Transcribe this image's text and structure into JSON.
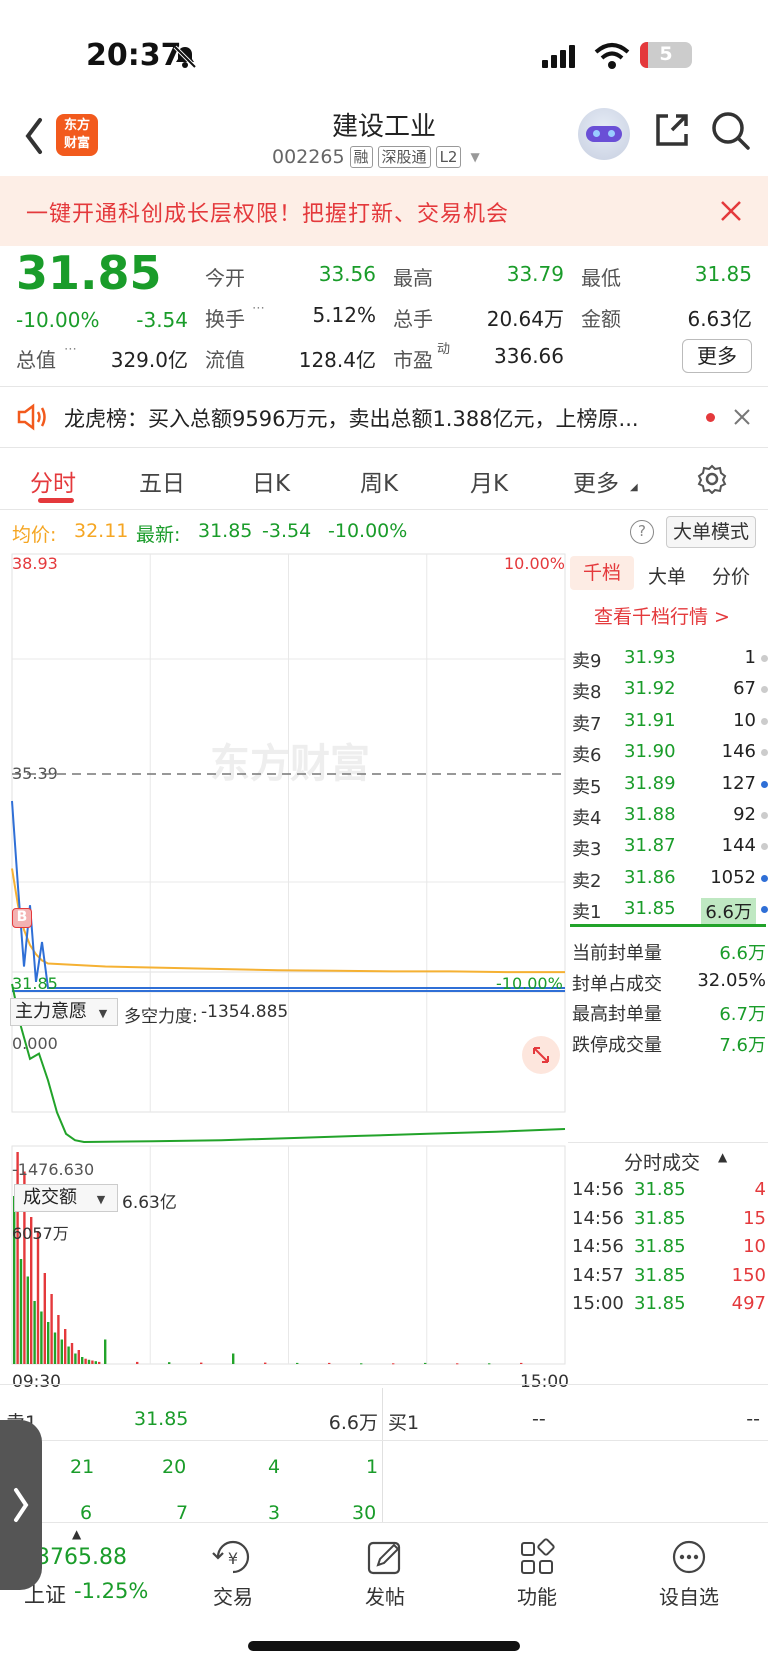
{
  "status_bar": {
    "time": "20:37",
    "battery": "5"
  },
  "header": {
    "logo_text": "东方\n财富",
    "title": "建设工业",
    "code": "002265",
    "tags": [
      "融",
      "深股通",
      "L2"
    ]
  },
  "banner": {
    "text": "一键开通科创成长层权限！把握打新、交易机会"
  },
  "quote": {
    "price": "31.85",
    "change_pct": "-10.00%",
    "change": "-3.54",
    "open_label": "今开",
    "open": "33.56",
    "high_label": "最高",
    "high": "33.79",
    "low_label": "最低",
    "low": "31.85",
    "turnover_label": "换手",
    "turnover": "5.12%",
    "volume_label": "总手",
    "volume": "20.64万",
    "amount_label": "金额",
    "amount": "6.63亿",
    "mktcap_label": "总值",
    "mktcap": "329.0亿",
    "float_label": "流值",
    "float_cap": "128.4亿",
    "pe_label": "市盈",
    "pe_sup": "动",
    "pe": "336.66",
    "more_label": "更多"
  },
  "dragon_tiger": {
    "text": "龙虎榜：买入总额9596万元，卖出总额1.388亿元，上榜原..."
  },
  "tabs": [
    "分时",
    "五日",
    "日K",
    "周K",
    "月K",
    "更多"
  ],
  "info_line": {
    "avg_label": "均价:",
    "avg": "32.11",
    "latest_label": "最新:",
    "latest": "31.85",
    "change": "-3.54",
    "pct": "-10.00%",
    "mode_button": "大单模式"
  },
  "chart": {
    "y_top": "38.93",
    "y_mid": "35.39",
    "y_bottom": "31.85",
    "pct_top": "10.00%",
    "pct_bottom": "-10.00%",
    "watermark": "东方财富",
    "b_marker": "B",
    "indicator_label": "主力意愿",
    "indicator_title": "多空力度:",
    "indicator_value": "-1354.885",
    "indicator_top": "0.000",
    "indicator_bottom": "-1476.630",
    "volume_label": "成交额",
    "volume_total": "6.63亿",
    "volume_max": "6057万",
    "time_start": "09:30",
    "time_end": "15:00"
  },
  "chart_data": {
    "type": "line",
    "x_range": [
      "09:30",
      "15:00"
    ],
    "ylim": [
      31.85,
      38.93
    ],
    "price_series": [
      34.9,
      33.5,
      32.2,
      33.2,
      31.95,
      32.6,
      31.85,
      31.85,
      31.85,
      31.85,
      31.85,
      31.85,
      31.85,
      31.85,
      31.85,
      31.85
    ],
    "avg_series": [
      33.8,
      33.2,
      32.8,
      32.55,
      32.4,
      32.3,
      32.25,
      32.2,
      32.18,
      32.16,
      32.14,
      32.13,
      32.12,
      32.12,
      32.11,
      32.11
    ],
    "indicator_series": [
      0,
      -400,
      -700,
      -650,
      -900,
      -1200,
      -1400,
      -1460,
      -1476.63,
      -1470,
      -1460,
      -1440,
      -1420,
      -1400,
      -1380,
      -1354.885
    ],
    "volume_series": [
      4800,
      6057,
      3000,
      5500,
      2500,
      4200,
      1800,
      3800,
      1500,
      2600,
      1200,
      2000,
      900,
      1400,
      700,
      1000,
      500,
      600,
      300,
      400,
      200,
      150,
      120,
      100,
      80,
      60,
      700,
      60,
      50,
      40,
      300,
      40,
      30,
      30,
      20,
      20,
      30,
      20,
      20,
      30
    ]
  },
  "order_book": {
    "tabs": [
      "千档",
      "大单",
      "分价"
    ],
    "link": "查看千档行情 >",
    "asks": [
      {
        "label": "卖9",
        "price": "31.93",
        "vol": "1"
      },
      {
        "label": "卖8",
        "price": "31.92",
        "vol": "67"
      },
      {
        "label": "卖7",
        "price": "31.91",
        "vol": "10"
      },
      {
        "label": "卖6",
        "price": "31.90",
        "vol": "146"
      },
      {
        "label": "卖5",
        "price": "31.89",
        "vol": "127"
      },
      {
        "label": "卖4",
        "price": "31.88",
        "vol": "92"
      },
      {
        "label": "卖3",
        "price": "31.87",
        "vol": "144"
      },
      {
        "label": "卖2",
        "price": "31.86",
        "vol": "1052"
      },
      {
        "label": "卖1",
        "price": "31.85",
        "vol": "6.6万"
      }
    ],
    "stats": [
      {
        "label": "当前封单量",
        "value": "6.6万"
      },
      {
        "label": "封单占成交",
        "value": "32.05%"
      },
      {
        "label": "最高封单量",
        "value": "6.7万"
      },
      {
        "label": "跌停成交量",
        "value": "7.6万"
      }
    ],
    "ticks_title": "分时成交",
    "ticks": [
      {
        "time": "14:56",
        "price": "31.85",
        "vol": "4"
      },
      {
        "time": "14:56",
        "price": "31.85",
        "vol": "15"
      },
      {
        "time": "14:56",
        "price": "31.85",
        "vol": "10"
      },
      {
        "time": "14:57",
        "price": "31.85",
        "vol": "150"
      },
      {
        "time": "15:00",
        "price": "31.85",
        "vol": "497"
      }
    ]
  },
  "bottom_quote": {
    "sell1_label": "卖1",
    "sell1_price": "31.85",
    "sell1_vol": "6.6万",
    "buy1_label": "买1",
    "buy1_price": "--",
    "buy1_vol": "--",
    "row1": [
      "21",
      "20",
      "4",
      "1"
    ],
    "row2": [
      "6",
      "7",
      "3",
      "30"
    ]
  },
  "nav": {
    "index_value": "3765.88",
    "index_name": "上证",
    "index_change": "-1.25%",
    "items": [
      "交易",
      "发帖",
      "功能",
      "设自选"
    ]
  }
}
